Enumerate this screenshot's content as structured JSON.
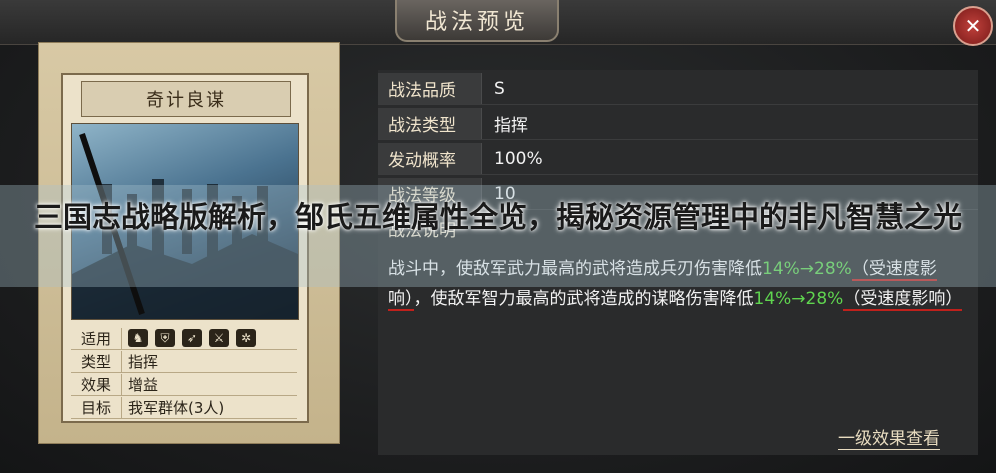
{
  "dialog": {
    "title": "战法预览",
    "close_glyph": "✕"
  },
  "card": {
    "name": "奇计良谋",
    "rows": {
      "suitable_label": "适用",
      "suitable_icons": [
        "cavalry-icon",
        "shield-icon",
        "bow-icon",
        "spear-icon",
        "siege-icon"
      ],
      "type_label": "类型",
      "type_value": "指挥",
      "effect_label": "效果",
      "effect_value": "增益",
      "target_label": "目标",
      "target_value": "我军群体(3人)"
    }
  },
  "info": {
    "quality_label": "战法品质",
    "quality_value": "S",
    "type_label": "战法类型",
    "type_value": "指挥",
    "rate_label": "发动概率",
    "rate_value": "100%",
    "level_label": "战法等级",
    "level_value": "10",
    "desc_label": "战法说明",
    "desc_1": "战斗中，使敌军武力最高的武将造成兵刃伤害降低",
    "desc_2": "14%",
    "desc_3": "→28%",
    "desc_4": "（受速度影响）",
    "desc_5": "，使敌军智力最高的武将造成的谋略伤害降低",
    "desc_6": "14%→28%",
    "desc_7": "（受速度影响）",
    "more_link": "一级效果查看"
  },
  "banner": {
    "title": "三国志战略版解析，邹氏五维属性全览，揭秘资源管理中的非凡智慧之光"
  }
}
